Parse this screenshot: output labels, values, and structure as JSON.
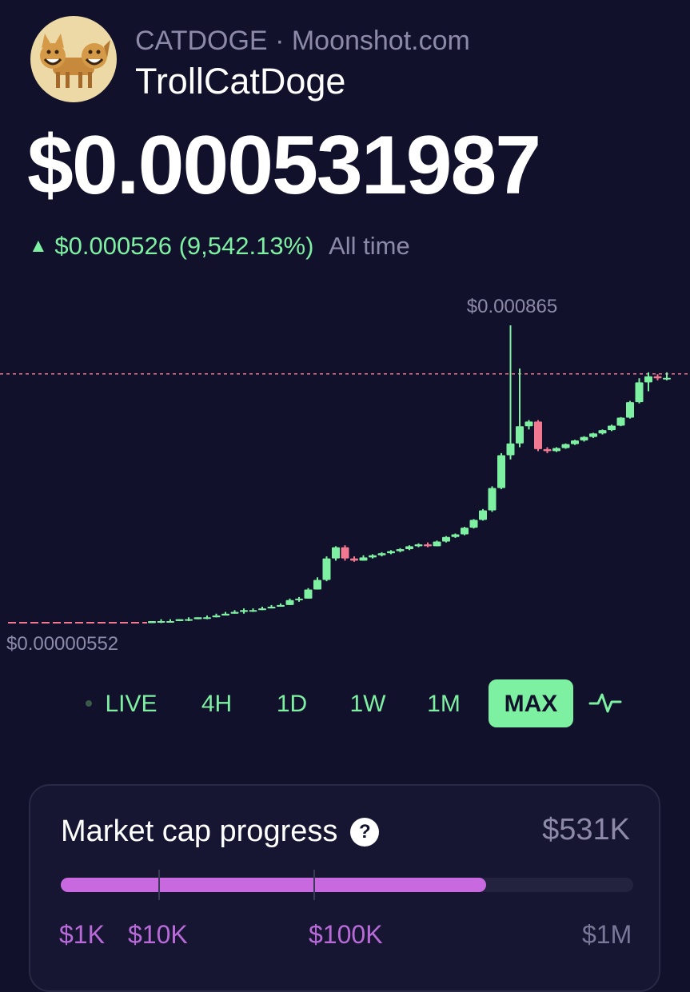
{
  "token": {
    "ticker": "CATDOGE",
    "separator": "·",
    "source": "Moonshot.com",
    "name": "TrollCatDoge"
  },
  "price": {
    "current": "$0.000531987",
    "change_abs": "$0.000526",
    "change_pct": "(9,542.13%)",
    "period": "All time",
    "direction_icon": "triangle-up-icon"
  },
  "chart_data": {
    "type": "candlestick",
    "high_label": "$0.000865",
    "low_label": "$0.00000552",
    "reference_line": "current price",
    "color_up": "#7ef0a2",
    "color_down": "#f07890",
    "series": [
      {
        "o": 5.5,
        "h": 5.6,
        "l": 5.5,
        "c": 5.6
      },
      {
        "o": 5.6,
        "h": 5.7,
        "l": 5.5,
        "c": 5.6
      },
      {
        "o": 5.6,
        "h": 5.7,
        "l": 5.6,
        "c": 5.6
      },
      {
        "o": 5.6,
        "h": 5.7,
        "l": 5.6,
        "c": 5.7
      },
      {
        "o": 5.7,
        "h": 5.8,
        "l": 5.6,
        "c": 5.7
      },
      {
        "o": 5.7,
        "h": 5.8,
        "l": 5.7,
        "c": 5.8
      },
      {
        "o": 5.8,
        "h": 5.9,
        "l": 5.7,
        "c": 5.8
      },
      {
        "o": 5.8,
        "h": 6.0,
        "l": 5.8,
        "c": 5.9
      },
      {
        "o": 5.9,
        "h": 6.1,
        "l": 5.9,
        "c": 6.0
      },
      {
        "o": 6.0,
        "h": 6.2,
        "l": 6.0,
        "c": 6.1
      },
      {
        "o": 6.1,
        "h": 6.3,
        "l": 6.0,
        "c": 6.2
      },
      {
        "o": 6.2,
        "h": 6.3,
        "l": 6.1,
        "c": 6.2
      },
      {
        "o": 6.2,
        "h": 6.4,
        "l": 6.2,
        "c": 6.3
      },
      {
        "o": 6.3,
        "h": 6.5,
        "l": 6.3,
        "c": 6.4
      },
      {
        "o": 6.4,
        "h": 6.6,
        "l": 6.4,
        "c": 6.5
      },
      {
        "o": 6.5,
        "h": 6.9,
        "l": 6.5,
        "c": 6.8
      },
      {
        "o": 6.8,
        "h": 7.0,
        "l": 6.7,
        "c": 6.9
      },
      {
        "o": 6.9,
        "h": 7.6,
        "l": 6.9,
        "c": 7.5
      },
      {
        "o": 7.5,
        "h": 8.4,
        "l": 7.5,
        "c": 8.2
      },
      {
        "o": 8.2,
        "h": 10.2,
        "l": 8.1,
        "c": 10.0
      },
      {
        "o": 10.0,
        "h": 11.2,
        "l": 9.8,
        "c": 11.1
      },
      {
        "o": 11.1,
        "h": 11.3,
        "l": 9.8,
        "c": 10.0
      },
      {
        "o": 10.0,
        "h": 10.2,
        "l": 9.7,
        "c": 9.8
      },
      {
        "o": 9.8,
        "h": 10.3,
        "l": 9.8,
        "c": 10.1
      },
      {
        "o": 10.1,
        "h": 10.4,
        "l": 10.0,
        "c": 10.3
      },
      {
        "o": 10.3,
        "h": 10.6,
        "l": 10.2,
        "c": 10.5
      },
      {
        "o": 10.5,
        "h": 10.8,
        "l": 10.4,
        "c": 10.7
      },
      {
        "o": 10.7,
        "h": 11.0,
        "l": 10.6,
        "c": 10.9
      },
      {
        "o": 10.9,
        "h": 11.3,
        "l": 10.8,
        "c": 11.2
      },
      {
        "o": 11.2,
        "h": 11.5,
        "l": 11.1,
        "c": 11.4
      },
      {
        "o": 11.4,
        "h": 11.6,
        "l": 11.1,
        "c": 11.2
      },
      {
        "o": 11.2,
        "h": 11.8,
        "l": 11.2,
        "c": 11.7
      },
      {
        "o": 11.7,
        "h": 12.3,
        "l": 11.6,
        "c": 12.2
      },
      {
        "o": 12.2,
        "h": 12.6,
        "l": 12.1,
        "c": 12.5
      },
      {
        "o": 12.5,
        "h": 13.4,
        "l": 12.4,
        "c": 13.3
      },
      {
        "o": 13.3,
        "h": 14.4,
        "l": 13.2,
        "c": 14.3
      },
      {
        "o": 14.3,
        "h": 15.8,
        "l": 14.2,
        "c": 15.6
      },
      {
        "o": 15.6,
        "h": 19.5,
        "l": 15.4,
        "c": 19.2
      },
      {
        "o": 19.2,
        "h": 26.5,
        "l": 19.0,
        "c": 26.0
      },
      {
        "o": 26.0,
        "h": 86.5,
        "l": 25.0,
        "c": 29.0
      },
      {
        "o": 29.0,
        "h": 58.0,
        "l": 28.0,
        "c": 34.0
      },
      {
        "o": 34.0,
        "h": 36.0,
        "l": 33.0,
        "c": 35.5
      },
      {
        "o": 35.5,
        "h": 36.0,
        "l": 27.0,
        "c": 27.5
      },
      {
        "o": 27.5,
        "h": 28.0,
        "l": 26.5,
        "c": 27.0
      },
      {
        "o": 27.0,
        "h": 28.0,
        "l": 26.8,
        "c": 27.8
      },
      {
        "o": 27.8,
        "h": 29.0,
        "l": 27.6,
        "c": 28.8
      },
      {
        "o": 28.8,
        "h": 30.0,
        "l": 28.6,
        "c": 29.8
      },
      {
        "o": 29.8,
        "h": 31.0,
        "l": 29.5,
        "c": 30.8
      },
      {
        "o": 30.8,
        "h": 32.0,
        "l": 30.5,
        "c": 31.8
      },
      {
        "o": 31.8,
        "h": 33.0,
        "l": 31.5,
        "c": 32.8
      },
      {
        "o": 32.8,
        "h": 34.5,
        "l": 32.5,
        "c": 34.2
      },
      {
        "o": 34.2,
        "h": 37.0,
        "l": 34.0,
        "c": 36.8
      },
      {
        "o": 36.8,
        "h": 43.0,
        "l": 36.5,
        "c": 42.5
      },
      {
        "o": 42.5,
        "h": 53.0,
        "l": 42.0,
        "c": 51.0
      },
      {
        "o": 51.0,
        "h": 56.0,
        "l": 47.0,
        "c": 54.0
      },
      {
        "o": 54.0,
        "h": 55.0,
        "l": 52.0,
        "c": 53.0
      },
      {
        "o": 53.0,
        "h": 56.0,
        "l": 52.0,
        "c": 53.2
      }
    ]
  },
  "ranges": {
    "items": [
      "LIVE",
      "4H",
      "1D",
      "1W",
      "1M",
      "MAX"
    ],
    "active": "MAX",
    "chart_toggle_icon": "line-chart-icon"
  },
  "market_cap": {
    "title": "Market cap progress",
    "help_icon": "question-icon",
    "help_glyph": "?",
    "value": "$531K",
    "progress_fraction": 0.743,
    "tick_labels": [
      "$1K",
      "$10K",
      "$100K",
      "$1M"
    ],
    "tick_fractions": [
      0,
      0.333,
      0.667,
      1
    ],
    "bar_color": "#c869e0"
  }
}
